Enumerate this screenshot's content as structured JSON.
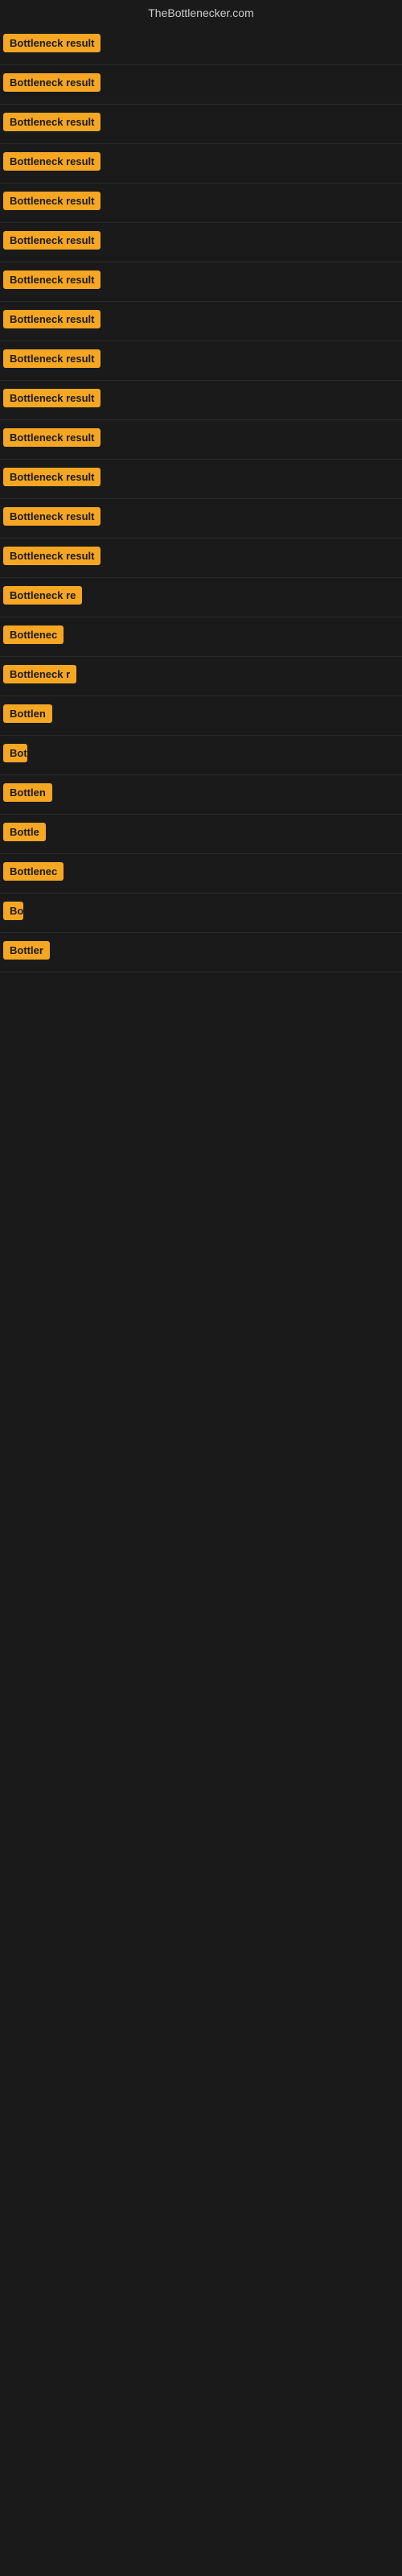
{
  "site": {
    "title": "TheBottlenecker.com"
  },
  "badge": {
    "colors": {
      "background": "#f5a623",
      "text": "#1a1a1a"
    }
  },
  "rows": [
    {
      "id": 1,
      "label": "Bottleneck result",
      "truncClass": "result-row-full"
    },
    {
      "id": 2,
      "label": "Bottleneck result",
      "truncClass": "result-row-full"
    },
    {
      "id": 3,
      "label": "Bottleneck result",
      "truncClass": "result-row-full"
    },
    {
      "id": 4,
      "label": "Bottleneck result",
      "truncClass": "result-row-full"
    },
    {
      "id": 5,
      "label": "Bottleneck result",
      "truncClass": "result-row-full"
    },
    {
      "id": 6,
      "label": "Bottleneck result",
      "truncClass": "result-row-full"
    },
    {
      "id": 7,
      "label": "Bottleneck result",
      "truncClass": "result-row-full"
    },
    {
      "id": 8,
      "label": "Bottleneck result",
      "truncClass": "result-row-full"
    },
    {
      "id": 9,
      "label": "Bottleneck result",
      "truncClass": "result-row-full"
    },
    {
      "id": 10,
      "label": "Bottleneck result",
      "truncClass": "result-row-full"
    },
    {
      "id": 11,
      "label": "Bottleneck result",
      "truncClass": "result-row-full"
    },
    {
      "id": 12,
      "label": "Bottleneck result",
      "truncClass": "result-row-full"
    },
    {
      "id": 13,
      "label": "Bottleneck result",
      "truncClass": "result-row-full"
    },
    {
      "id": 14,
      "label": "Bottleneck result",
      "truncClass": "result-row-full"
    },
    {
      "id": 15,
      "label": "Bottleneck re",
      "truncClass": "trunc-120"
    },
    {
      "id": 16,
      "label": "Bottlenec",
      "truncClass": "trunc-80"
    },
    {
      "id": 17,
      "label": "Bottleneck r",
      "truncClass": "trunc-100"
    },
    {
      "id": 18,
      "label": "Bottlen",
      "truncClass": "trunc-65"
    },
    {
      "id": 19,
      "label": "Bot",
      "truncClass": "trunc-30"
    },
    {
      "id": 20,
      "label": "Bottlen",
      "truncClass": "trunc-65"
    },
    {
      "id": 21,
      "label": "Bottle",
      "truncClass": "trunc-55"
    },
    {
      "id": 22,
      "label": "Bottlenec",
      "truncClass": "trunc-80"
    },
    {
      "id": 23,
      "label": "Bo",
      "truncClass": "trunc-25"
    },
    {
      "id": 24,
      "label": "Bottler",
      "truncClass": "trunc-60"
    }
  ]
}
